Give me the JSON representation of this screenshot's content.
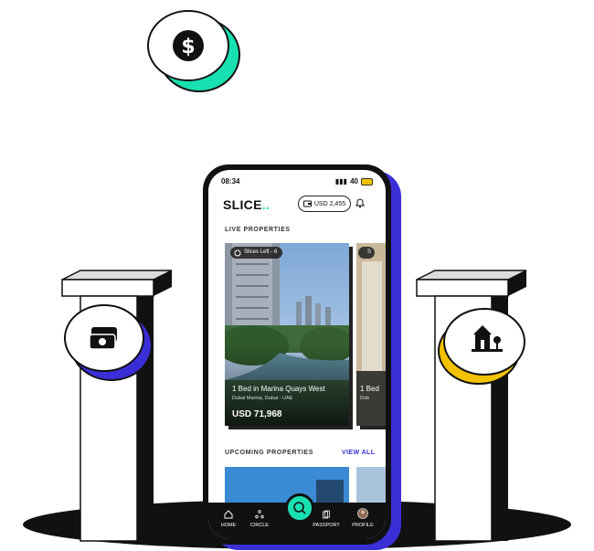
{
  "status_bar": {
    "time": "08:34",
    "signal": "40"
  },
  "header": {
    "logo": "SLICE",
    "logo_suffix": "..",
    "balance": "USD 2,455"
  },
  "sections": {
    "live": "LIVE PROPERTIES",
    "upcoming": "UPCOMING PROPERTIES",
    "view_all": "VIEW ALL"
  },
  "live_cards": [
    {
      "slices": "Slices Left - 6",
      "title": "1 Bed in Marina Quays West",
      "location": "Dubai Marina, Dubai - UAE",
      "price": "USD 71,968"
    },
    {
      "slices": "S",
      "title": "1 Bed",
      "location": "Dub"
    }
  ],
  "nav": {
    "home": "HOME",
    "circle": "CIRCLE",
    "passport": "PASSPORT",
    "profile": "PROFILE"
  },
  "icons": {
    "coin_top": "dollar-coin-icon",
    "coin_left": "money-stack-icon",
    "coin_right": "house-icon"
  },
  "colors": {
    "accent": "#19e0b0",
    "brand": "#3a2fd6",
    "yellow": "#f2c200"
  }
}
